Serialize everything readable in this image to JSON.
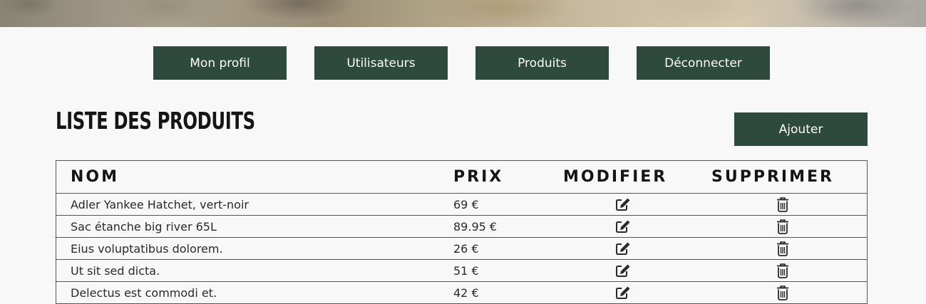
{
  "nav": {
    "profile": "Mon profil",
    "users": "Utilisateurs",
    "products": "Produits",
    "logout": "Déconnecter"
  },
  "page": {
    "title": "LISTE DES PRODUITS",
    "add_label": "Ajouter"
  },
  "table": {
    "headers": {
      "name": "NOM",
      "price": "PRIX",
      "edit": "MODIFIER",
      "delete": "SUPPRIMER"
    },
    "rows": [
      {
        "name": "Adler Yankee  Hatchet, vert-noir",
        "price": "69 €"
      },
      {
        "name": "Sac étanche big river 65L",
        "price": "89.95 €"
      },
      {
        "name": "Eius voluptatibus dolorem.",
        "price": "26 €"
      },
      {
        "name": "Ut sit sed dicta.",
        "price": "51 €"
      },
      {
        "name": "Delectus est commodi et.",
        "price": "42 €"
      }
    ]
  },
  "icons": {
    "edit": "edit-icon",
    "delete": "trash-icon"
  },
  "colors": {
    "accent": "#2e4a3d",
    "background": "#f8f8f8"
  }
}
